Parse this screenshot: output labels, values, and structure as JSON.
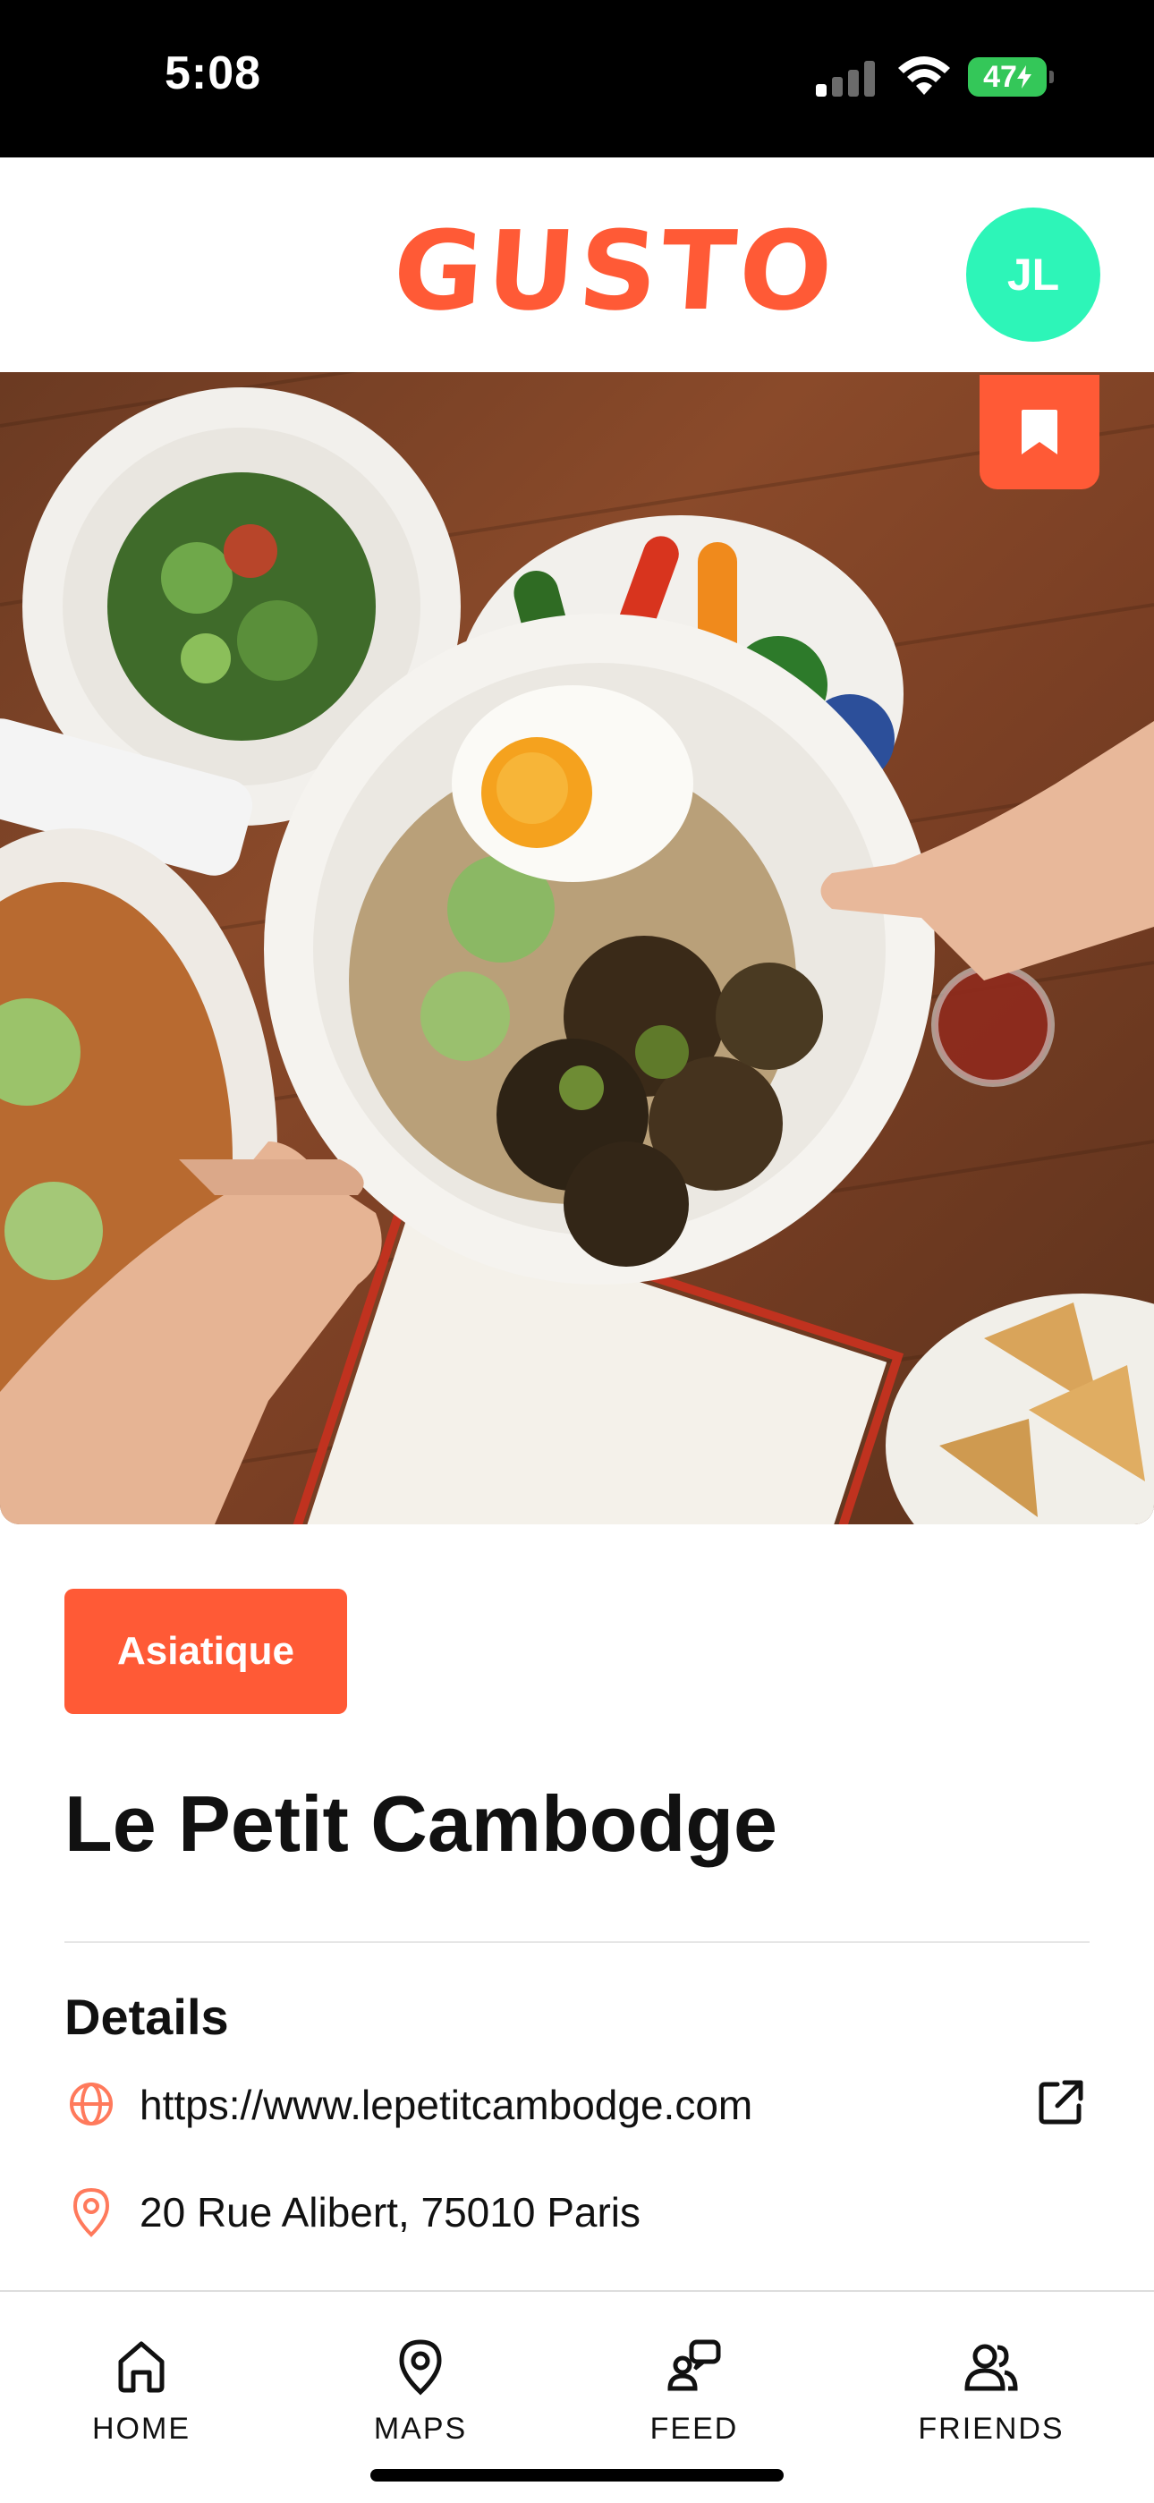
{
  "status_bar": {
    "time": "5:08",
    "battery": "47",
    "signal_icon": "cellular-signal-icon",
    "wifi_icon": "wifi-icon",
    "charging_icon": "lightning-bolt-icon"
  },
  "header": {
    "logo": "GUSTO",
    "avatar_initials": "JL",
    "avatar_color": "#2df5b8"
  },
  "hero": {
    "image_description": "Overhead shot of hands passing a bowl with a fried egg, rice and roasted brussels sprouts on a wooden table",
    "bookmark_icon": "bookmark-icon"
  },
  "restaurant": {
    "category": "Asiatique",
    "name": "Le Petit Cambodge"
  },
  "details": {
    "title": "Details",
    "website": "https://www.lepetitcambodge.com",
    "address": "20 Rue Alibert, 75010 Paris",
    "website_icon": "globe-icon",
    "address_icon": "location-pin-icon",
    "external_link_icon": "external-link-icon"
  },
  "nav": {
    "items": [
      {
        "label": "HOME",
        "icon": "home-icon"
      },
      {
        "label": "MAPS",
        "icon": "map-pin-icon"
      },
      {
        "label": "FEED",
        "icon": "chat-bubbles-icon"
      },
      {
        "label": "FRIENDS",
        "icon": "users-icon"
      }
    ]
  },
  "colors": {
    "accent": "#ff5a36",
    "status_bar": "#000000",
    "battery": "#34c759"
  }
}
